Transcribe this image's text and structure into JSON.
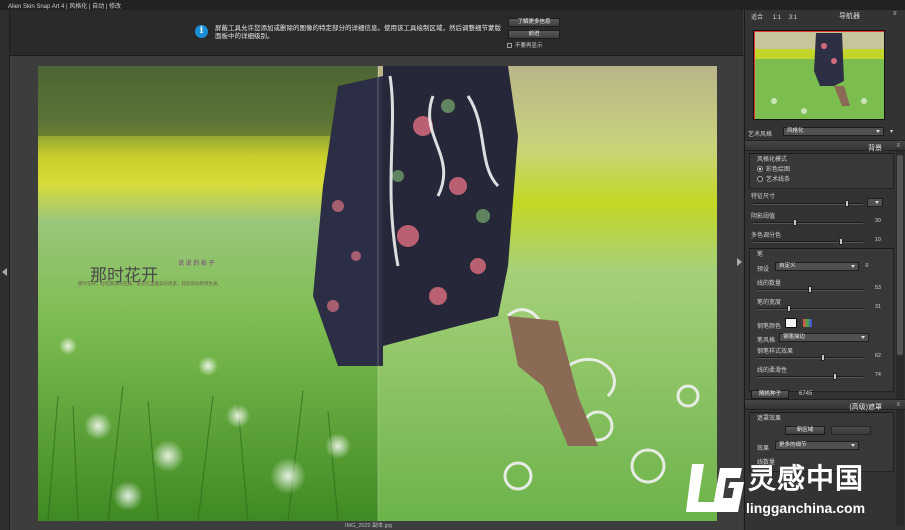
{
  "app": {
    "title": "Alien Skin Snap Art 4 | 风格化 | 自动 | 修改"
  },
  "infobar": {
    "message": "屏蔽工具允许您添加或删除的图像的特定部分的详细信息。使用该工具绘制区域，然后调整细节蒙版面板中的详细级别。",
    "learn_more": "了解更多信息",
    "close": "前进",
    "dont_show": "不要再显示"
  },
  "image": {
    "filename": "IMG_2022 副本.jpg",
    "overlay_title": "那时花开",
    "overlay_sub": "说 说 的 影 子",
    "overlay_caption": "那时花开，轻轻飘落的花瓣，是记忆里最美的风景。轻轻风动摇曳生姿。"
  },
  "panel": {
    "top_labels": [
      "适合",
      "1:1",
      "3:1"
    ],
    "navigator": "导航器",
    "art_style_label": "艺术风格",
    "art_style_value": "风格化",
    "background_header": "背景",
    "mode_group": "风格化模式",
    "mode_options": [
      "彩色绘图",
      "艺术线条"
    ],
    "feature_size": "特征尺寸",
    "threshold": {
      "label": "阴影阈值",
      "value": "30"
    },
    "multi_color": {
      "label": "多色调分色",
      "value": "10"
    },
    "pen_header": "笔",
    "preset": {
      "label": "预设",
      "value": "自定义"
    },
    "line_count": {
      "label": "线的数量",
      "value": "53"
    },
    "pen_width": {
      "label": "笔的宽度",
      "value": "31"
    },
    "pen_color": "钢笔颜色",
    "pen_style": {
      "label": "笔风格",
      "value": "钢笔描边"
    },
    "style_effect": {
      "label": "钢笔样式效果",
      "value": "62"
    },
    "line_smooth": {
      "label": "线的柔滑性",
      "value": "74"
    },
    "random_seed": {
      "label": "随机种子",
      "value": "6745"
    },
    "mask_header": "(高级)遮罩",
    "mask_effect": "遮罩效果",
    "new_button": "新区域",
    "mask_effect_label": "效果",
    "mask_effect_value": "更多的细节",
    "line_count2": "线数量"
  },
  "watermark": {
    "brand": "灵感中国",
    "url": "lingganchina.com"
  },
  "colors": {
    "accent": "#1a8fd6",
    "panel": "#333333",
    "canvas": "#3d3d3d"
  }
}
